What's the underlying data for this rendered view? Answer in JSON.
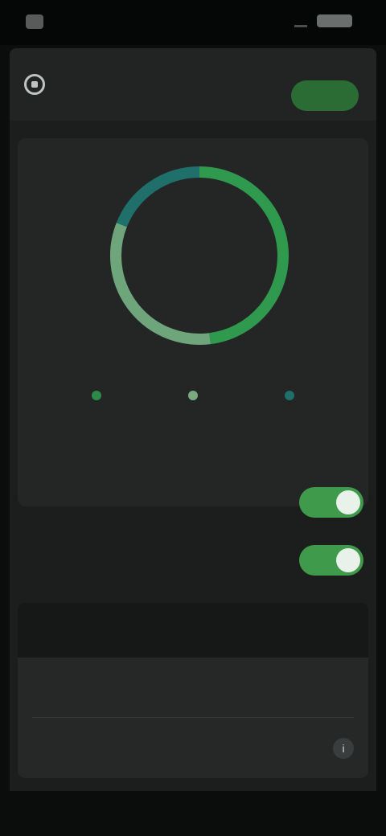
{
  "status_bar": {
    "time": "",
    "battery_text": ""
  },
  "header": {
    "title": "",
    "action_label": ""
  },
  "ring": {
    "value": "",
    "caption": "",
    "segments": [
      {
        "fraction": 0.48,
        "color": "#2f9a4e"
      },
      {
        "fraction": 0.33,
        "color": "#6fa57a"
      },
      {
        "fraction": 0.19,
        "color": "#1f6f6a"
      }
    ]
  },
  "stats": [
    {
      "value": "",
      "label": "",
      "color": "#2e8b47"
    },
    {
      "value": "",
      "label": "",
      "color": "#7aa983"
    },
    {
      "value": "",
      "label": "",
      "color": "#1e6f6a"
    }
  ],
  "toggles": [
    {
      "label": "",
      "on": true
    },
    {
      "label": "",
      "on": true
    }
  ],
  "section": {
    "title": ""
  },
  "settings": [
    {
      "label": "",
      "value": ""
    },
    {
      "label": "",
      "value": ""
    }
  ],
  "colors": {
    "accent": "#3f9a4b",
    "background": "#1c1e1e",
    "card": "#242626"
  }
}
